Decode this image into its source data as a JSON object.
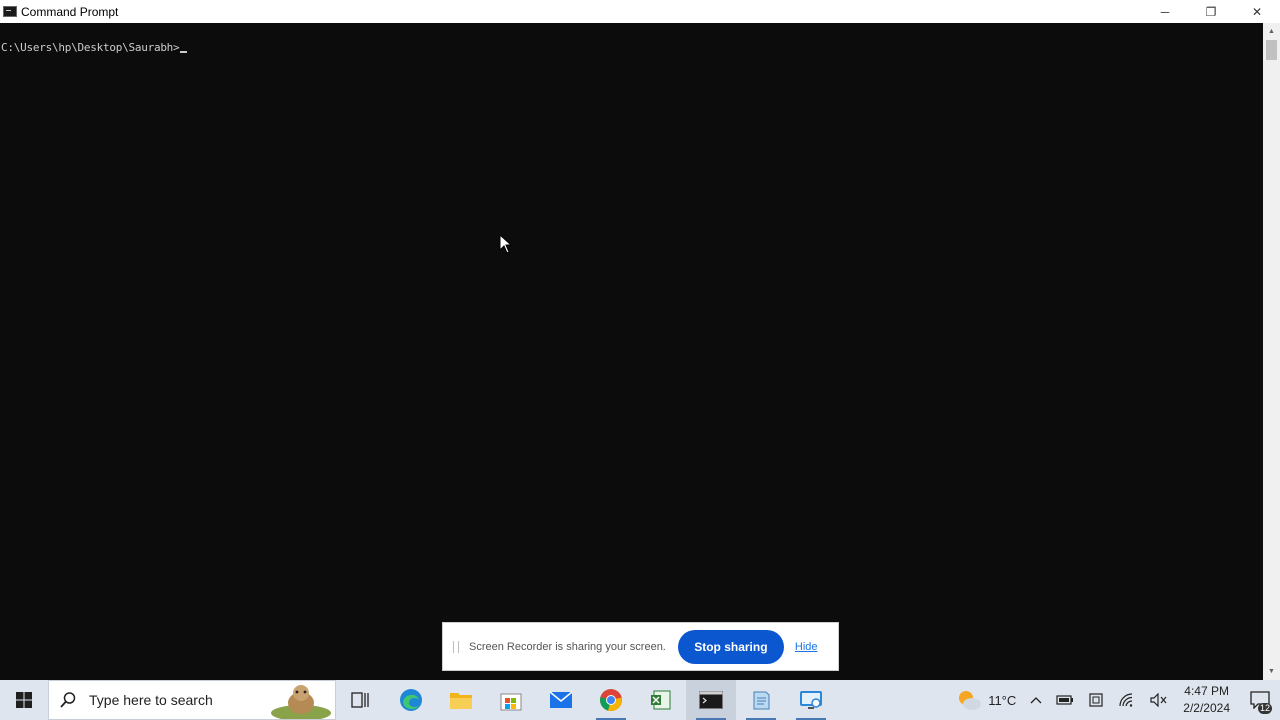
{
  "window": {
    "title": "Command Prompt",
    "controls": {
      "minimize": "─",
      "restore": "❐",
      "close": "✕"
    }
  },
  "console": {
    "prompt": "C:\\Users\\hp\\Desktop\\Saurabh>"
  },
  "share_bar": {
    "message": "Screen Recorder is sharing your screen.",
    "stop_label": "Stop sharing",
    "hide_label": "Hide"
  },
  "taskbar": {
    "search_placeholder": "Type here to search",
    "apps": [
      "task-view-icon",
      "edge-icon",
      "file-explorer-icon",
      "store-icon",
      "mail-icon",
      "chrome-icon",
      "spreadsheet-icon",
      "cmd-icon",
      "notepad-icon",
      "remote-icon"
    ],
    "weather": "11°C",
    "time": "4:47 PM",
    "date": "2/2/2024",
    "notifications": "12"
  },
  "colors": {
    "console_bg": "#0c0c0c",
    "console_text": "#cccccc",
    "accent": "#0b57d0",
    "taskbar_bg": "#dfe5ee"
  }
}
